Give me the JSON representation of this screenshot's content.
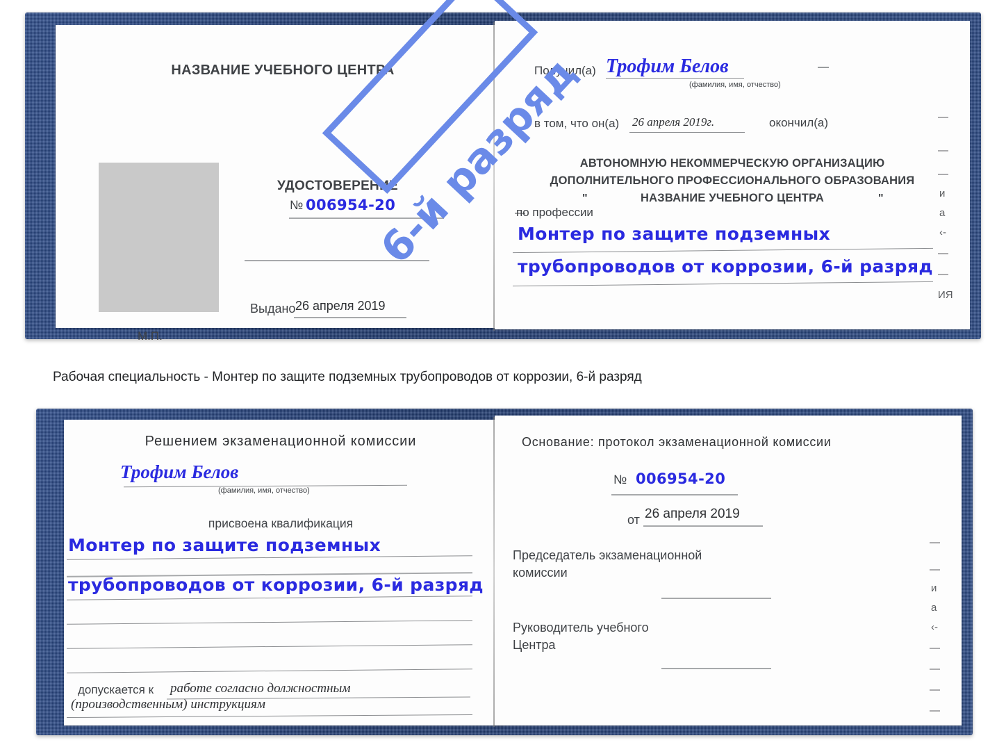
{
  "caption": {
    "text": "Рабочая специальность - Монтер по защите подземных трубопроводов от коррозии, 6-й разряд"
  },
  "watermark": {
    "text": "6-й разряд",
    "color": "#6a8ae8"
  },
  "colors": {
    "cover_blue": "#2c4c8c",
    "ink_blue": "#2a2ae0",
    "photo_gray": "#c9c9c9",
    "rule_gray": "#8b8d90"
  },
  "certificate_top": {
    "left_page": {
      "center_name": "НАЗВАНИЕ УЧЕБНОГО ЦЕНТРА",
      "doc_title": "УДОСТОВЕРЕНИЕ",
      "number_label": "№",
      "number_value": "006954-20",
      "issued_label": "Выдано",
      "issued_value": "26 апреля 2019",
      "seal_label": "М.П.",
      "photo_alt": "photo-placeholder"
    },
    "right_page": {
      "received_label": "Получил(а)",
      "received_value": "Трофим Белов",
      "name_hint": "(фамилия, имя, отчество)",
      "completed_prefix": "в том, что он(а)",
      "completed_date": "26 апреля 2019г.",
      "completed_suffix": "окончил(а)",
      "org_line1": "АВТОНОМНУЮ НЕКОММЕРЧЕСКУЮ ОРГАНИЗАЦИЮ",
      "org_line2": "ДОПОЛНИТЕЛЬНОГО ПРОФЕССИОНАЛЬНОГО ОБРАЗОВАНИЯ",
      "org_quote_open": "\"",
      "org_line3": "НАЗВАНИЕ УЧЕБНОГО ЦЕНТРА",
      "org_quote_close": "\"",
      "profession_label": "по профессии",
      "profession_line1": "Монтер по защите подземных",
      "profession_line2": "трубопроводов от коррозии, 6-й разряд",
      "margin_fragments": [
        "—",
        "—",
        "ИЯ",
        "—",
        "и",
        "а",
        "‹-",
        "—",
        "—",
        "—",
        "—"
      ]
    }
  },
  "certificate_bottom": {
    "left_page": {
      "heading": "Решением экзаменационной комиссии",
      "name_value": "Трофим Белов",
      "name_hint": "(фамилия, имя, отчество)",
      "qualification_label": "присвоена квалификация",
      "qualification_line1": "Монтер по защите подземных",
      "qualification_line2": "трубопроводов от коррозии, 6-й разряд",
      "admitted_label": "допускается к",
      "admitted_value_line1": "работе согласно должностным",
      "admitted_value_line2": "(производственным) инструкциям"
    },
    "right_page": {
      "basis_label": "Основание: протокол экзаменационной комиссии",
      "protocol_number_label": "№",
      "protocol_number_value": "006954-20",
      "protocol_date_label": "от",
      "protocol_date_value": "26 апреля 2019",
      "chairman_line1": "Председатель экзаменационной",
      "chairman_line2": "комиссии",
      "director_line1": "Руководитель учебного",
      "director_line2": "Центра",
      "margin_fragments": [
        "—",
        "—",
        "и",
        "а",
        "‹-",
        "—",
        "—",
        "—",
        "—"
      ]
    }
  }
}
